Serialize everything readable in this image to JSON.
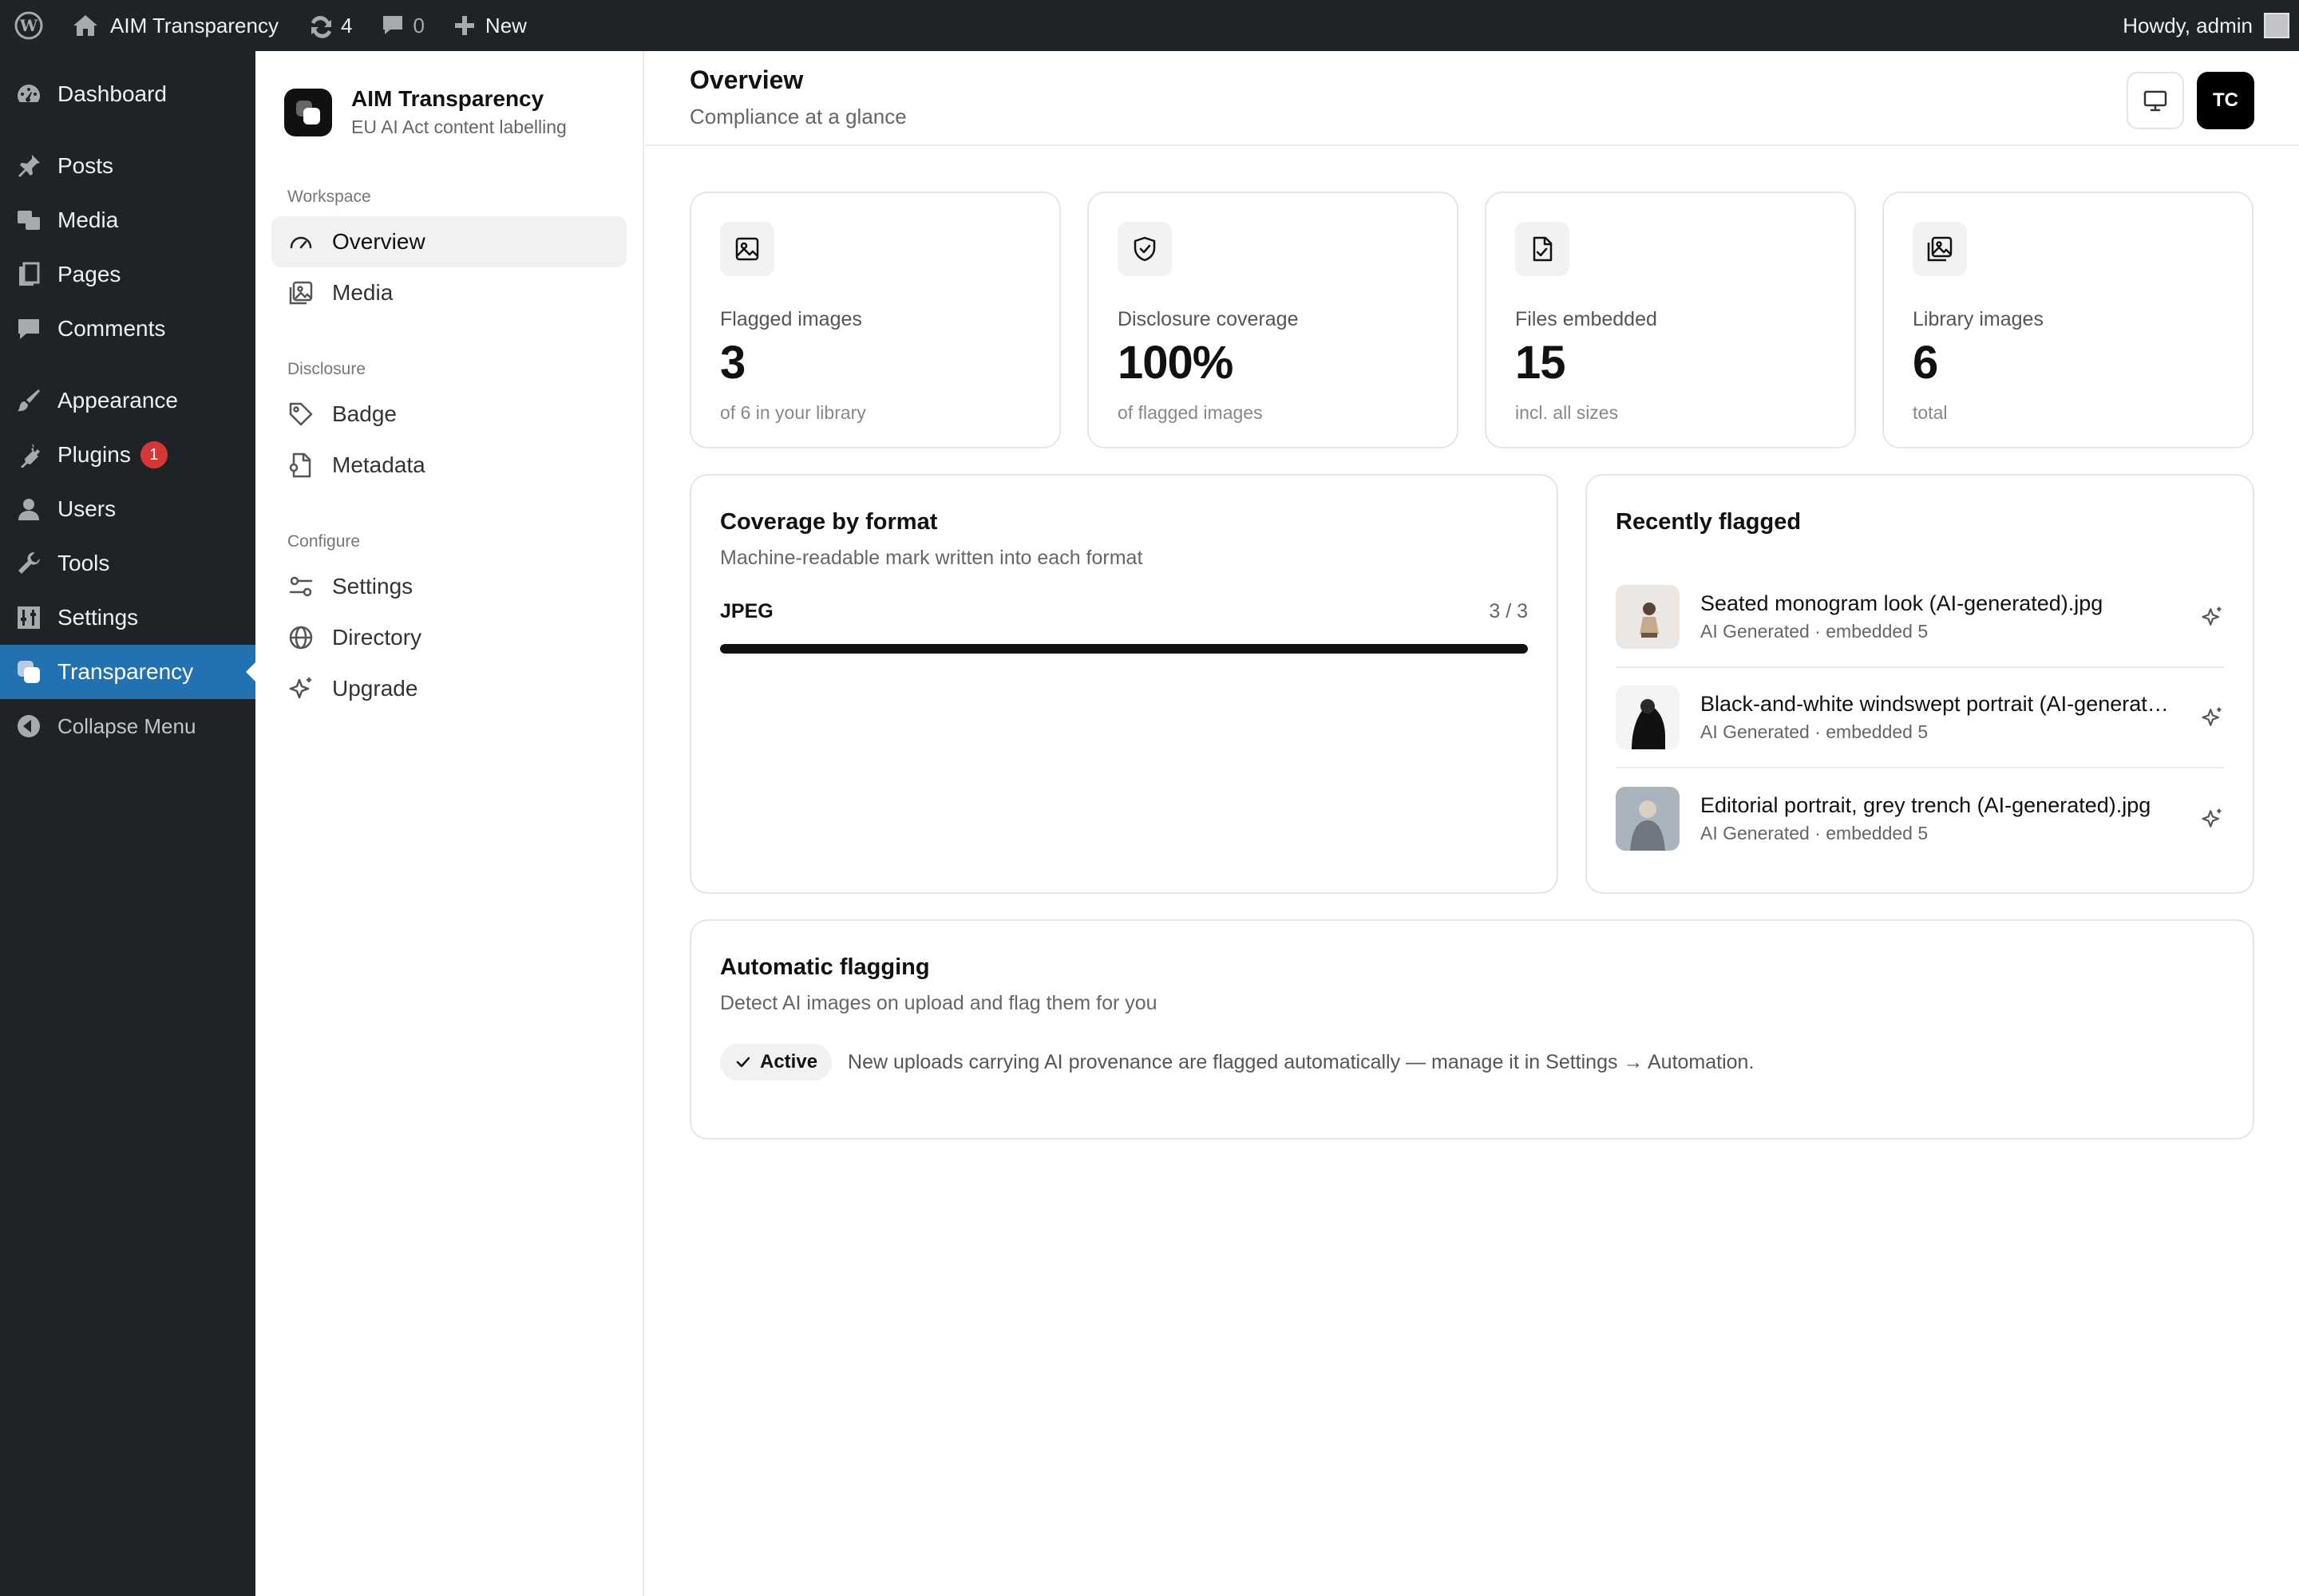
{
  "adminbar": {
    "site_name": "AIM Transparency",
    "updates_count": "4",
    "comments_count": "0",
    "new_label": "New",
    "howdy": "Howdy, admin"
  },
  "wpmenu": {
    "items": [
      {
        "label": "Dashboard",
        "icon": "dashboard-icon"
      },
      {
        "label": "Posts",
        "icon": "pin-icon"
      },
      {
        "label": "Media",
        "icon": "media-icon"
      },
      {
        "label": "Pages",
        "icon": "pages-icon"
      },
      {
        "label": "Comments",
        "icon": "comment-icon"
      },
      {
        "label": "Appearance",
        "icon": "brush-icon"
      },
      {
        "label": "Plugins",
        "icon": "plug-icon",
        "badge": "1"
      },
      {
        "label": "Users",
        "icon": "user-icon"
      },
      {
        "label": "Tools",
        "icon": "wrench-icon"
      },
      {
        "label": "Settings",
        "icon": "sliders-icon"
      },
      {
        "label": "Transparency",
        "icon": "transparency-icon"
      },
      {
        "label": "Collapse Menu",
        "icon": "collapse-icon"
      }
    ]
  },
  "plugin": {
    "name": "AIM Transparency",
    "tagline": "EU AI Act content labelling",
    "sections": {
      "workspace": "Workspace",
      "disclosure": "Disclosure",
      "configure": "Configure"
    },
    "nav": {
      "overview": "Overview",
      "media": "Media",
      "badge": "Badge",
      "metadata": "Metadata",
      "settings": "Settings",
      "directory": "Directory",
      "upgrade": "Upgrade"
    }
  },
  "header": {
    "title": "Overview",
    "subtitle": "Compliance at a glance",
    "avatar_initials": "TC"
  },
  "stats": [
    {
      "label": "Flagged images",
      "value": "3",
      "foot": "of 6 in your library",
      "icon": "image-icon"
    },
    {
      "label": "Disclosure coverage",
      "value": "100%",
      "foot": "of flagged images",
      "icon": "shield-check-icon"
    },
    {
      "label": "Files embedded",
      "value": "15",
      "foot": "incl. all sizes",
      "icon": "file-check-icon"
    },
    {
      "label": "Library images",
      "value": "6",
      "foot": "total",
      "icon": "gallery-icon"
    }
  ],
  "coverage": {
    "title": "Coverage by format",
    "subtitle": "Machine-readable mark written into each format",
    "rows": [
      {
        "format": "JPEG",
        "count": "3 / 3",
        "fraction": 1.0
      }
    ]
  },
  "recent": {
    "title": "Recently flagged",
    "items": [
      {
        "name": "Seated monogram look (AI-generated).jpg",
        "meta": "AI Generated · embedded 5"
      },
      {
        "name": "Black-and-white windswept portrait (AI-generated).jpg",
        "meta": "AI Generated · embedded 5"
      },
      {
        "name": "Editorial portrait, grey trench (AI-generated).jpg",
        "meta": "AI Generated · embedded 5"
      }
    ]
  },
  "automation": {
    "title": "Automatic flagging",
    "subtitle": "Detect AI images on upload and flag them for you",
    "status": "Active",
    "description": "New uploads carrying AI provenance are flagged automatically — manage it in Settings → Automation."
  },
  "colors": {
    "wp_dark": "#1d2327",
    "wp_active": "#2271b1",
    "badge_red": "#d63638",
    "accent_black": "#000000"
  }
}
